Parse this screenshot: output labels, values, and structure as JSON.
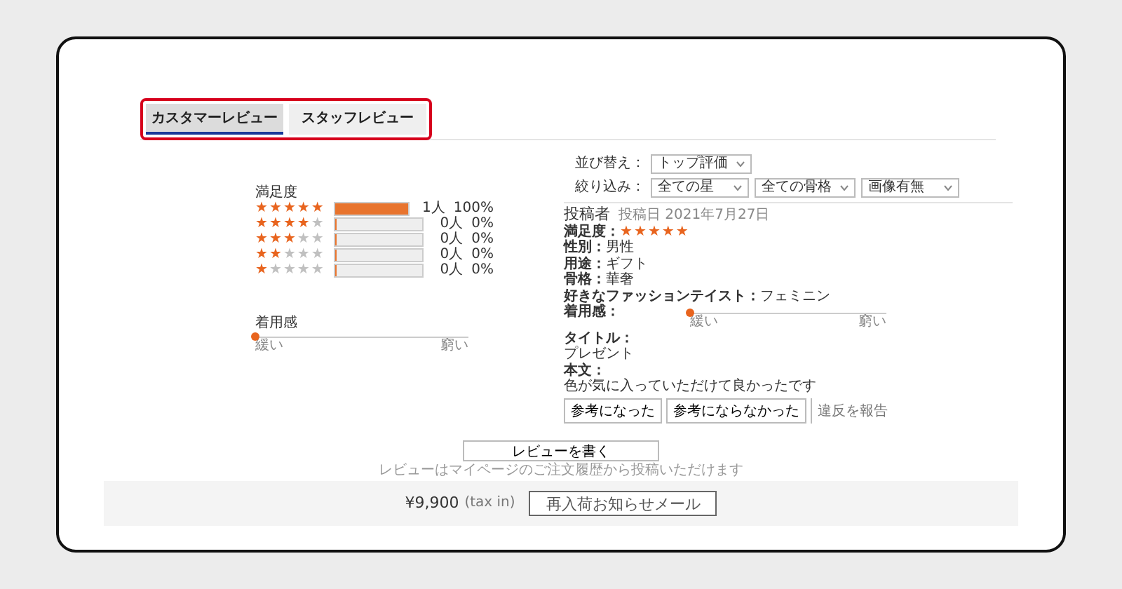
{
  "tabs": [
    {
      "label": "カスタマーレビュー",
      "selected": true
    },
    {
      "label": "スタッフレビュー",
      "selected": false
    }
  ],
  "summary": {
    "title": "満足度",
    "rows": [
      {
        "stars": 5,
        "level": 1,
        "count": "1人",
        "percent": "100%"
      },
      {
        "stars": 4,
        "level": 0,
        "count": "0人",
        "percent": "0%"
      },
      {
        "stars": 3,
        "level": 0,
        "count": "0人",
        "percent": "0%"
      },
      {
        "stars": 2,
        "level": 0,
        "count": "0人",
        "percent": "0%"
      },
      {
        "stars": 1,
        "level": 0,
        "count": "0人",
        "percent": "0%"
      }
    ],
    "fit": {
      "label": "着用感",
      "level": 0,
      "min_label": "緩い",
      "max_label": "窮い"
    }
  },
  "sort": {
    "label": "並び替え：",
    "value": "トップ評価"
  },
  "filter": {
    "label": "絞り込み：",
    "selects": [
      "全ての星",
      "全ての骨格",
      "画像有無"
    ]
  },
  "review": {
    "author": "投稿者",
    "date": "投稿日 2021年7月27日",
    "rating_label": "満足度：",
    "stars": 5,
    "fields": [
      {
        "label": "性別：",
        "value": "男性"
      },
      {
        "label": "用途：",
        "value": "ギフト"
      },
      {
        "label": "骨格：",
        "value": "華奢"
      },
      {
        "label": "好きなファッションテイスト：",
        "value": "フェミニン"
      }
    ],
    "fit": {
      "label": "着用感：",
      "level": 0,
      "min_label": "緩い",
      "max_label": "窮い"
    },
    "title_label": "タイトル：",
    "title": "プレゼント",
    "body_label": "本文：",
    "body": "色が気に入っていただけて良かったです",
    "buttons": [
      "参考になった",
      "参考にならなかった"
    ],
    "report": "違反を報告"
  },
  "write_button": "レビューを書く",
  "note": "レビューはマイページのご注文履歴から投稿いただけます",
  "price": "¥9,900",
  "tax": "(tax in)",
  "restock_button": "再入荷お知らせメール"
}
